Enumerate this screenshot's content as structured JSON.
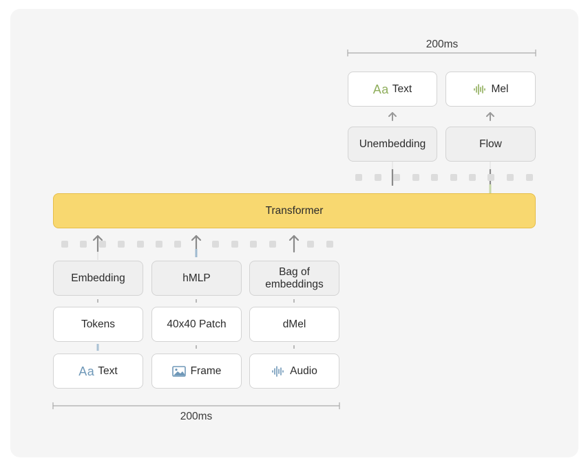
{
  "top": {
    "duration_label": "200ms",
    "outputs": {
      "text_prefix": "Aa",
      "text_label": "Text",
      "mel_label": "Mel"
    },
    "decoders": {
      "unembedding_label": "Unembedding",
      "flow_label": "Flow"
    }
  },
  "transformer": {
    "label": "Transformer"
  },
  "bottom": {
    "encoders": {
      "embedding_label": "Embedding",
      "hmlp_label": "hMLP",
      "bag_label": "Bag of embeddings"
    },
    "tokenizers": {
      "tokens_label": "Tokens",
      "patch_label": "40x40 Patch",
      "dmel_label": "dMel"
    },
    "inputs": {
      "text_prefix": "Aa",
      "text_label": "Text",
      "frame_label": "Frame",
      "audio_label": "Audio"
    },
    "duration_label": "200ms"
  },
  "colors": {
    "transformer_fill": "#f8d870",
    "text_accent_green": "#8fae5c",
    "input_accent_blue": "#6f98b8"
  },
  "icons": [
    "text-aa-icon",
    "waveform-icon",
    "image-icon",
    "up-arrow-icon"
  ]
}
